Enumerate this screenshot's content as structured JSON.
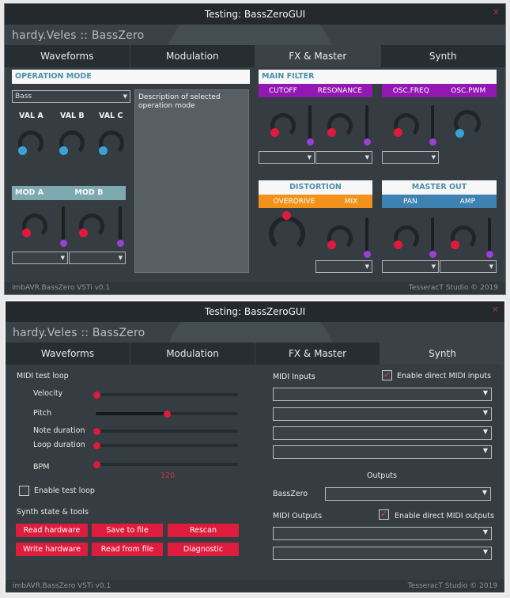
{
  "window1": {
    "title": "Testing: BassZeroGUI",
    "brand": "hardy.Veles :: BassZero",
    "tabs": [
      "Waveforms",
      "Modulation",
      "FX & Master",
      "Synth"
    ],
    "active_tab": "FX & Master",
    "operation_mode": {
      "header": "OPERATION MODE",
      "select_value": "Bass",
      "description": "Description of selected operation mode",
      "knob_labels": [
        "VAL A",
        "VAL B",
        "VAL C"
      ]
    },
    "mod": {
      "label_a": "MOD A",
      "label_b": "MOD B"
    },
    "main_filter": {
      "header": "MAIN FILTER",
      "labels": [
        "CUTOFF",
        "RESONANCE",
        "OSC.FREQ",
        "OSC.PWM"
      ]
    },
    "distortion": {
      "header": "DISTORTION",
      "labels": [
        "OVERDRIVE",
        "MIX"
      ]
    },
    "master_out": {
      "header": "MASTER OUT",
      "labels": [
        "PAN",
        "AMP"
      ]
    },
    "footer_left": "imbAVR.BassZero VSTi v0.1",
    "footer_right": "TesseracT Studio © 2019"
  },
  "window2": {
    "title": "Testing: BassZeroGUI",
    "brand": "hardy.Veles :: BassZero",
    "tabs": [
      "Waveforms",
      "Modulation",
      "FX & Master",
      "Synth"
    ],
    "active_tab": "Synth",
    "midi_test_loop": {
      "header": "MIDI test loop",
      "sliders": [
        {
          "label": "Velocity",
          "value": 0.0
        },
        {
          "label": "Pitch",
          "value": 0.5
        },
        {
          "label": "Note duration",
          "value": 0.0
        },
        {
          "label": "Loop duration",
          "value": 0.0
        },
        {
          "label": "BPM",
          "value": 0.0
        }
      ],
      "bpm_value": "120",
      "enable_label": "Enable test loop",
      "enable_checked": false
    },
    "synth_tools": {
      "header": "Synth state & tools",
      "buttons": [
        "Read hardware",
        "Save to file",
        "Rescan",
        "Write hardware",
        "Read from file",
        "Diagnostic"
      ]
    },
    "midi_inputs": {
      "label": "MIDI Inputs",
      "enable_label": "Enable direct MIDI inputs",
      "enable_checked": true
    },
    "outputs": {
      "header": "Outputs",
      "basszero_label": "BassZero"
    },
    "midi_outputs": {
      "label": "MIDI Outputs",
      "enable_label": "Enable direct MIDI outputs",
      "enable_checked": true
    },
    "footer_left": "imbAVR.BassZero VSTi v0.1",
    "footer_right": "TesseracT Studio © 2019"
  },
  "colors": {
    "accent_red": "#e01a3c",
    "accent_purple": "#9317b3",
    "accent_orange": "#f2921a",
    "accent_blue": "#3d82b3",
    "knob_blue": "#3aa3d6"
  }
}
